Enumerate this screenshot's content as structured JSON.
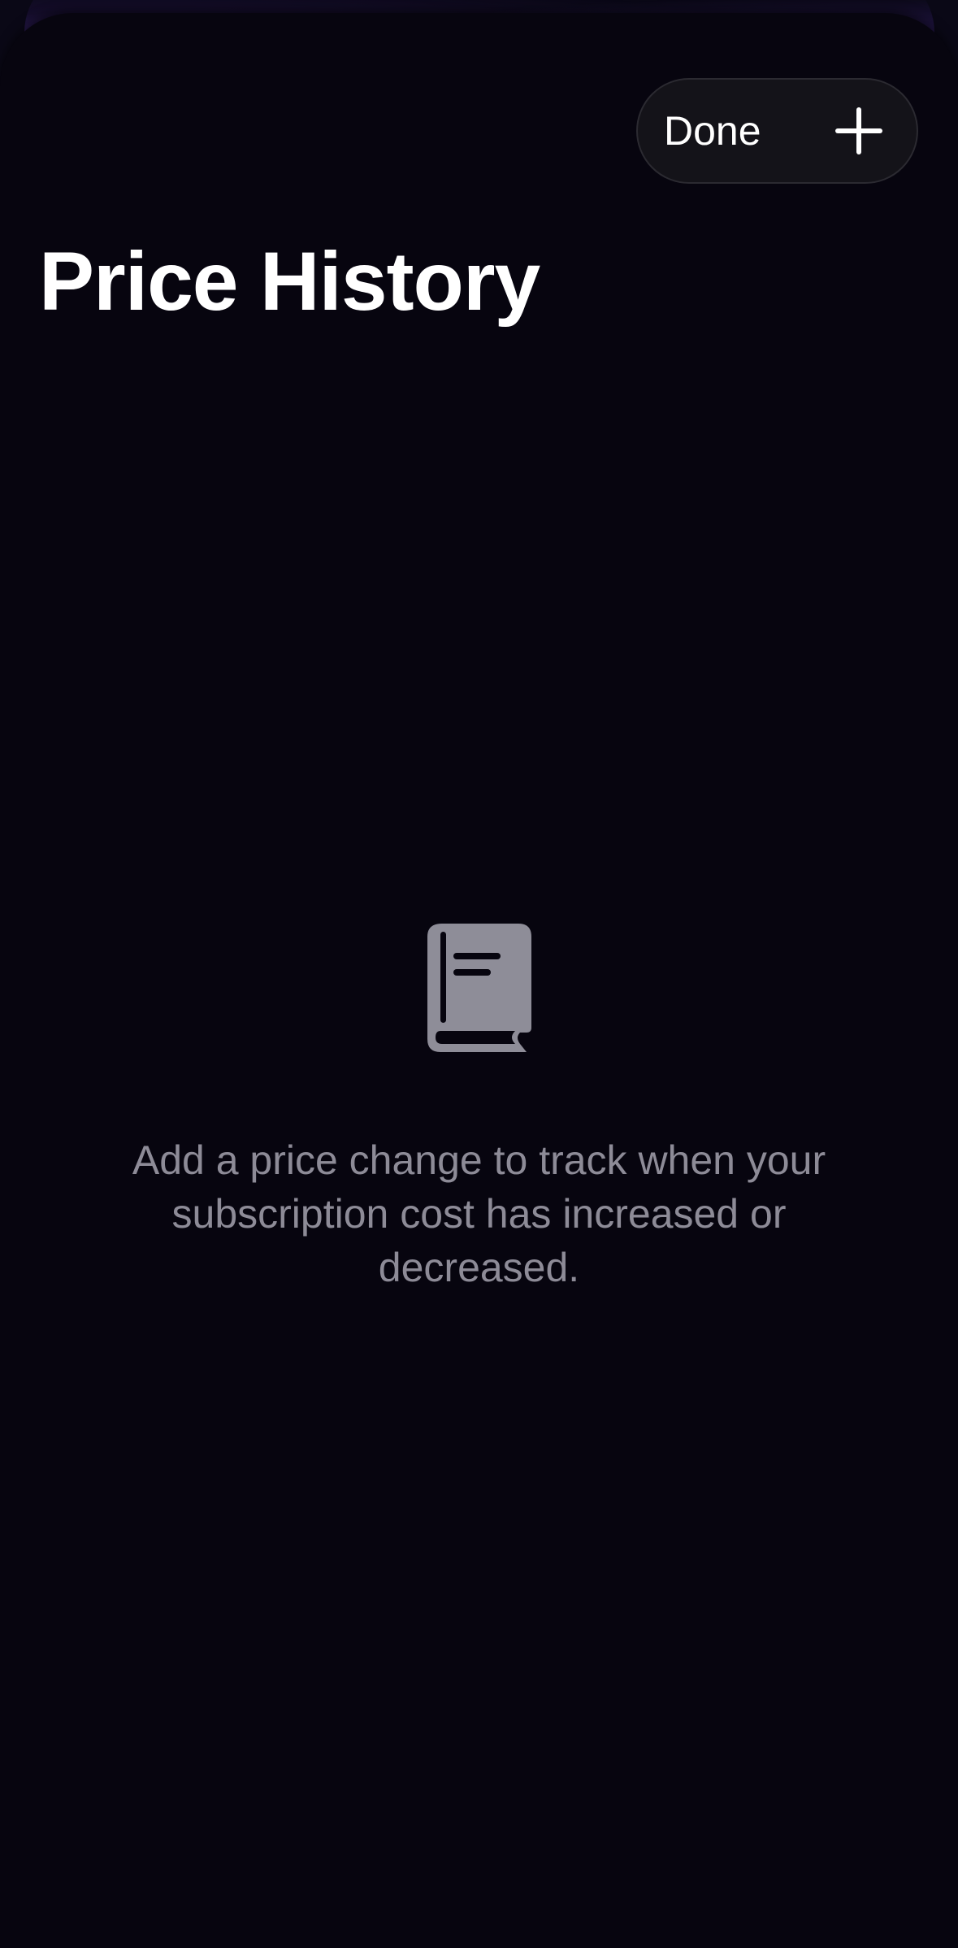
{
  "toolbar": {
    "done_label": "Done",
    "add_icon": "plus-icon"
  },
  "page": {
    "title": "Price History"
  },
  "empty_state": {
    "icon": "book-icon",
    "message": "Add a price change to track when your subscription cost has increased or decreased."
  },
  "colors": {
    "background": "#07050f",
    "pill_background": "#141319",
    "title": "#ffffff",
    "muted_text": "#8d8b97",
    "icon": "#8e8d98"
  }
}
